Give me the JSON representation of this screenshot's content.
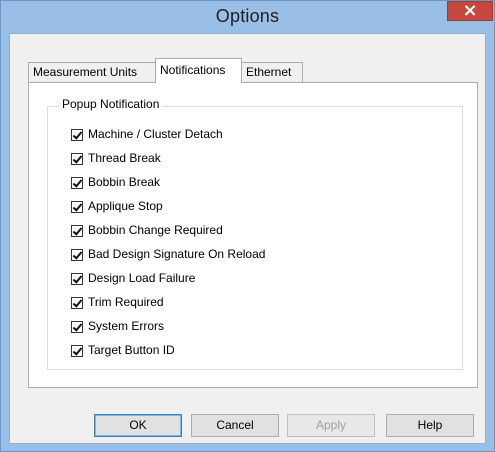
{
  "window": {
    "title": "Options",
    "close_symbol": "×"
  },
  "tabs": [
    {
      "label": "Measurement Units",
      "active": false
    },
    {
      "label": "Notifications",
      "active": true
    },
    {
      "label": "Ethernet",
      "active": false
    }
  ],
  "group": {
    "label": "Popup Notification"
  },
  "checkboxes": [
    {
      "label": "Machine / Cluster Detach",
      "checked": true
    },
    {
      "label": "Thread Break",
      "checked": true
    },
    {
      "label": "Bobbin Break",
      "checked": true
    },
    {
      "label": "Applique Stop",
      "checked": true
    },
    {
      "label": "Bobbin Change Required",
      "checked": true
    },
    {
      "label": "Bad Design Signature On Reload",
      "checked": true
    },
    {
      "label": "Design Load Failure",
      "checked": true
    },
    {
      "label": "Trim Required",
      "checked": true
    },
    {
      "label": "System Errors",
      "checked": true
    },
    {
      "label": "Target Button ID",
      "checked": true
    }
  ],
  "buttons": {
    "ok": "OK",
    "cancel": "Cancel",
    "apply": "Apply",
    "help": "Help"
  },
  "colors": {
    "frame": "#99bfe6",
    "close_button": "#c7483f",
    "dialog_bg": "#f0f0f0"
  }
}
